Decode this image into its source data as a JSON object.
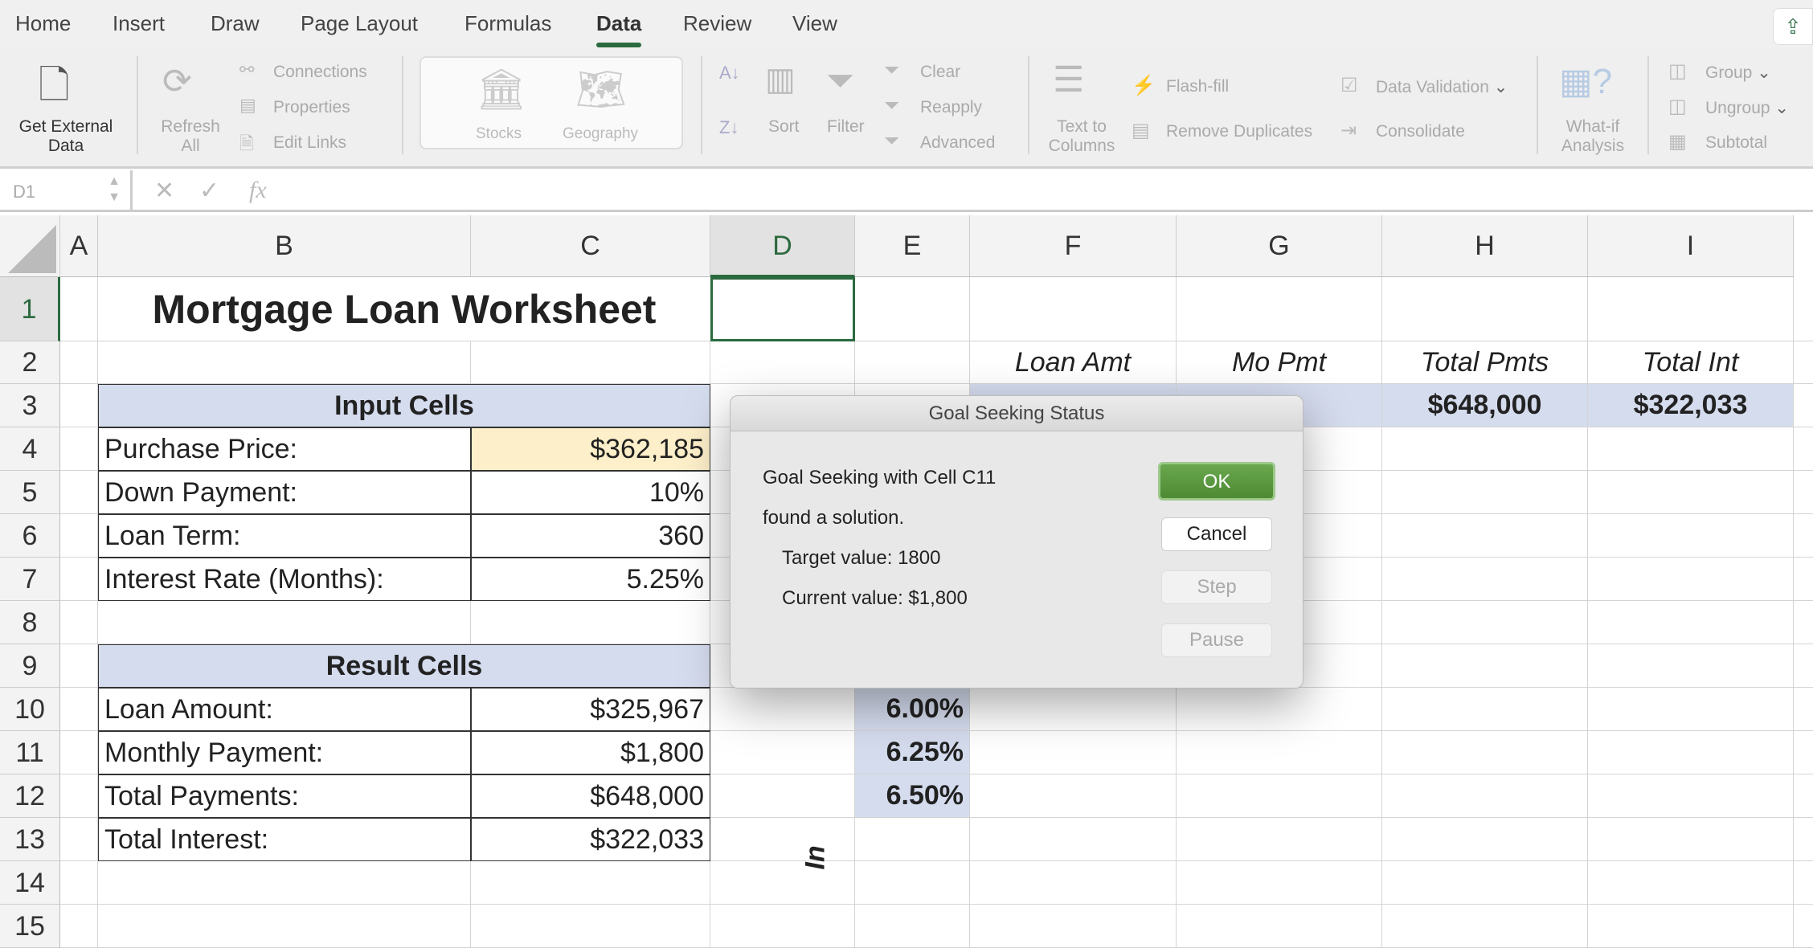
{
  "tabs": [
    "Home",
    "Insert",
    "Draw",
    "Page Layout",
    "Formulas",
    "Data",
    "Review",
    "View"
  ],
  "active_tab": "Data",
  "accent": "#2b6a3f",
  "ribbon": {
    "get_external_data": "Get External Data",
    "refresh_all": "Refresh All",
    "connections": "Connections",
    "properties": "Properties",
    "edit_links": "Edit Links",
    "stocks": "Stocks",
    "geography": "Geography",
    "sort": "Sort",
    "filter": "Filter",
    "clear": "Clear",
    "reapply": "Reapply",
    "advanced": "Advanced",
    "text_to_columns": "Text to Columns",
    "flash_fill": "Flash-fill",
    "remove_duplicates": "Remove Duplicates",
    "data_validation": "Data Validation",
    "consolidate": "Consolidate",
    "what_if": "What-if Analysis",
    "group": "Group",
    "ungroup": "Ungroup",
    "subtotal": "Subtotal"
  },
  "formula_bar": {
    "name_box": "D1",
    "fx": "fx",
    "value": ""
  },
  "columns": [
    "A",
    "B",
    "C",
    "D",
    "E",
    "F",
    "G",
    "H",
    "I"
  ],
  "selected_column": "D",
  "rows": [
    "1",
    "2",
    "3",
    "4",
    "5",
    "6",
    "7",
    "8",
    "9",
    "10",
    "11",
    "12",
    "13",
    "14",
    "15"
  ],
  "sheet": {
    "title": "Mortgage Loan Worksheet",
    "input_header": "Input Cells",
    "inputs": [
      {
        "label": "Purchase Price:",
        "value": "$362,185"
      },
      {
        "label": "Down Payment:",
        "value": "10%"
      },
      {
        "label": "Loan Term:",
        "value": "360"
      },
      {
        "label": "Interest Rate (Months):",
        "value": "5.25%"
      }
    ],
    "result_header": "Result Cells",
    "results": [
      {
        "label": "Loan Amount:",
        "value": "$325,967"
      },
      {
        "label": "Monthly Payment:",
        "value": "$1,800"
      },
      {
        "label": "Total Payments:",
        "value": "$648,000"
      },
      {
        "label": "Total Interest:",
        "value": "$322,033"
      }
    ],
    "table_headers": [
      "Loan Amt",
      "Mo Pmt",
      "Total Pmts",
      "Total Int"
    ],
    "table_row3": {
      "total_pmts": "$648,000",
      "total_int": "$322,033"
    },
    "rates": [
      "6.00%",
      "6.25%",
      "6.50%"
    ],
    "rotated_label": "In"
  },
  "dialog": {
    "title": "Goal Seeking Status",
    "line1": "Goal Seeking with Cell C11",
    "line2": "found a solution.",
    "target": "Target value:  1800",
    "current": "Current value:  $1,800",
    "ok": "OK",
    "cancel": "Cancel",
    "step": "Step",
    "pause": "Pause"
  }
}
